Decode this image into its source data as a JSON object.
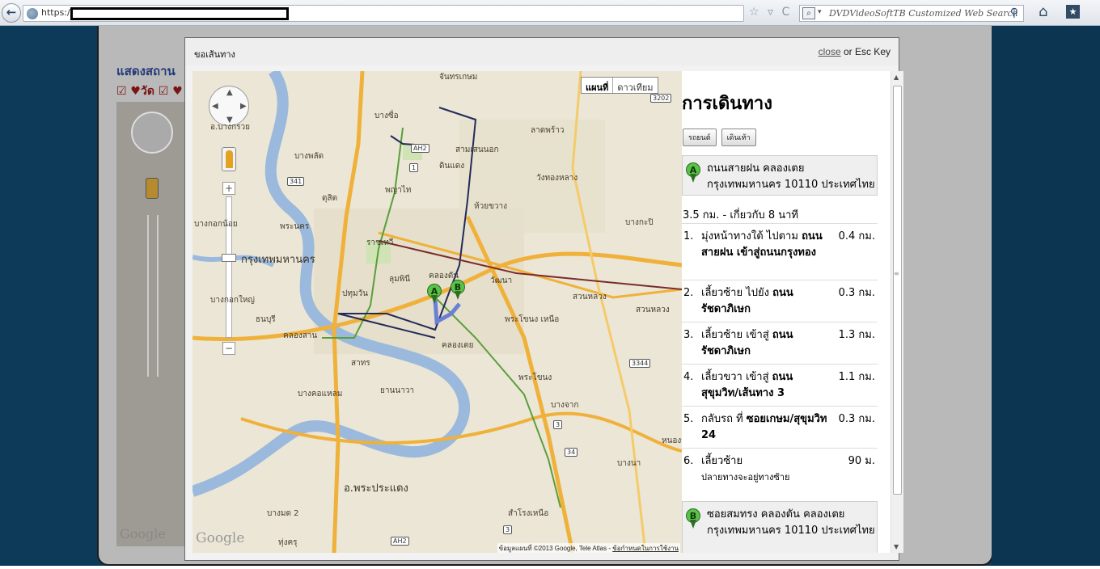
{
  "browser": {
    "url_prefix": "https:/",
    "url_icons": "☆ ▿ C",
    "search_placeholder": "DVDVideoSoftTB Customized Web Search"
  },
  "background_page": {
    "title": "แสดงสถาน",
    "legend": "☑ ♥วัด ☑ ♥",
    "map_logo": "Google"
  },
  "dialog": {
    "title": "ขอเส้นทาง",
    "close_link": "close",
    "close_suffix": "or Esc Key"
  },
  "map": {
    "type_buttons": [
      "แผนที่",
      "ดาวเทียม"
    ],
    "logo": "Google",
    "copyright": "ข้อมูลแผนที่ ©2013 Google, Tele Atlas -",
    "terms_link": "ข้อกำหนดในการใช้งาน",
    "markers": [
      "A",
      "B"
    ],
    "places": {
      "bangsue": "บางซื่อ",
      "chatuchak": "ลาดพร้าว",
      "dindaeng": "ดินแดง",
      "phayathai": "พญาไท",
      "huaikhwang": "ห้วยขวาง",
      "wangthonglang": "วังทองหลาง",
      "bangkapi": "บางกะปิ",
      "ratchathewi": "ราชเทวี",
      "bangkok": "กรุงเทพมหานคร",
      "pathumwan": "ปทุมวัน",
      "lumphini": "ลุมพินี",
      "khlongtan": "คลองตัน",
      "watthana": "วัฒนา",
      "suanluang": "สวนหลวง",
      "phrakhanong_n": "พระโขนง เหนือ",
      "khlongtoei": "คลองเตย",
      "sathon": "สาทร",
      "phrakhanong": "พระโขนง",
      "bangkholaem": "บางคอแหลม",
      "yannawa": "ยานนาวา",
      "bangchak": "บางจาก",
      "thonburi": "ธนบุรี",
      "khlongsan": "คลองสาน",
      "phrapradaeng": "อ.พระประแดง",
      "bangna": "บางนา",
      "bangkoknoi": "บางกอกน้อย",
      "bangkokyai": "บางกอกใหญ่",
      "bangphlat": "บางพลัด",
      "phranakhon": "พระนคร",
      "dusit": "ดุสิต",
      "samsennok": "สามเสนนอก",
      "chatuchak2": "จันทรเกษม",
      "bangkruai": "อ.บางกรวย",
      "bangmot": "บางมด 2",
      "thungkhru": "ทุ่งครุ",
      "samrongnuea": "สำโรงเหนือ",
      "phrakhanong_cross": "สวนหลวง",
      "nongbon": "หนองบ"
    },
    "road_badges": [
      "AH2",
      "1",
      "341",
      "3202",
      "3344",
      "3",
      "34",
      "3",
      "AH2"
    ]
  },
  "directions": {
    "title": "การเดินทาง",
    "mode_buttons": [
      "รถยนต์",
      "เดินเท้า"
    ],
    "origin_letter": "A",
    "origin": "ถนนสายฝน คลองเตย กรุงเทพมหานคร 10110 ประเทศไทย",
    "summary": "3.5 กม. - เกี่ยวกับ 8 นาที",
    "steps": [
      {
        "num": "1.",
        "pre": "มุ่งหน้าทางใต้ ไปตาม",
        "bold": "ถนนสายฝน เข้าสู่ถนนกรุงทอง",
        "dist": "0.4 กม."
      },
      {
        "num": "2.",
        "pre": "เลี้ยวซ้าย ไปยัง",
        "bold": "ถนนรัชดาภิเษก",
        "dist": "0.3 กม."
      },
      {
        "num": "3.",
        "pre": "เลี้ยวซ้าย เข้าสู่",
        "bold": "ถนนรัชดาภิเษก",
        "dist": "1.3 กม."
      },
      {
        "num": "4.",
        "pre": "เลี้ยวขวา เข้าสู่",
        "bold": "ถนนสุขุมวิท/เส้นทาง 3",
        "dist": "1.1 กม."
      },
      {
        "num": "5.",
        "pre": "กลับรถ ที่",
        "bold": "ซอยเกษม/สุขุมวิท 24",
        "dist": "0.3 กม."
      },
      {
        "num": "6.",
        "pre": "เลี้ยวซ้าย",
        "bold": "",
        "note": "ปลายทางจะอยู่ทางซ้าย",
        "dist": "90 ม."
      }
    ],
    "destination_letter": "B",
    "destination": "ซอยสมทรง คลองตัน คลองเตย กรุงเทพมหานคร 10110 ประเทศไทย"
  },
  "colors": {
    "route": "#6a7fd6",
    "transit_green": "#5a9e3a",
    "transit_navy": "#232a5c",
    "expressway": "#f0b13a",
    "river": "#9ab9dd"
  }
}
